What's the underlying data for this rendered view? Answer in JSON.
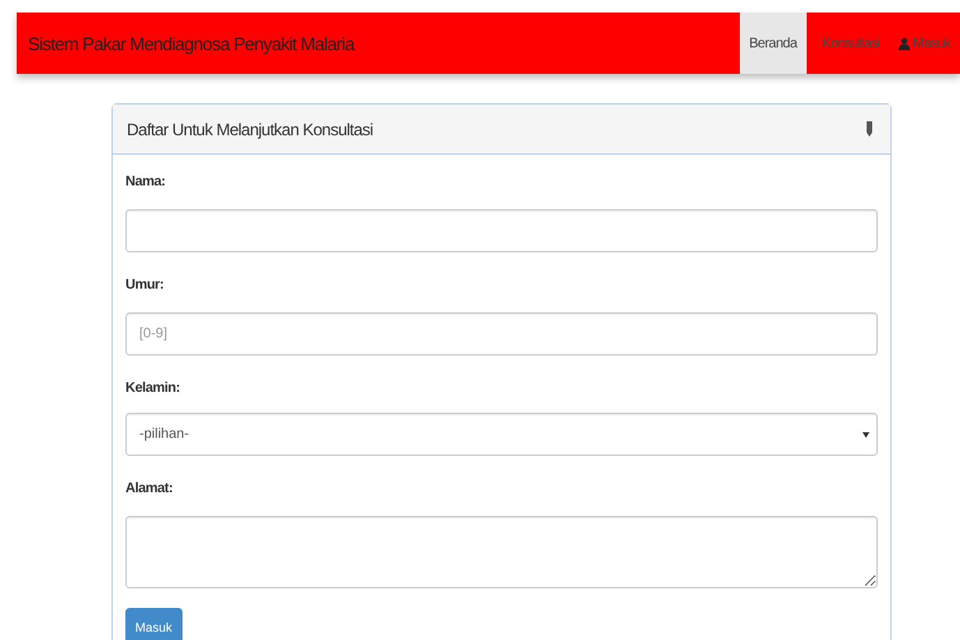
{
  "navbar": {
    "brand": "Sistem Pakar Mendiagnosa Penyakit Malaria",
    "items": [
      {
        "label": "Beranda",
        "selected": true,
        "kind": "link"
      },
      {
        "label": "Konsultasi",
        "selected": false,
        "kind": "link"
      },
      {
        "label": "Masuk",
        "selected": false,
        "kind": "user"
      }
    ]
  },
  "panel": {
    "title": "Daftar Untuk Melanjutkan Konsultasi",
    "fields": [
      {
        "label": "Nama:",
        "kind": "text"
      },
      {
        "label": "Umur:",
        "kind": "text",
        "placeholder": "[0-9]"
      },
      {
        "label": "Kelamin:",
        "kind": "select",
        "value": "-pilihan-"
      },
      {
        "label": "Alamat:",
        "kind": "textarea"
      }
    ],
    "button": "Masuk"
  }
}
